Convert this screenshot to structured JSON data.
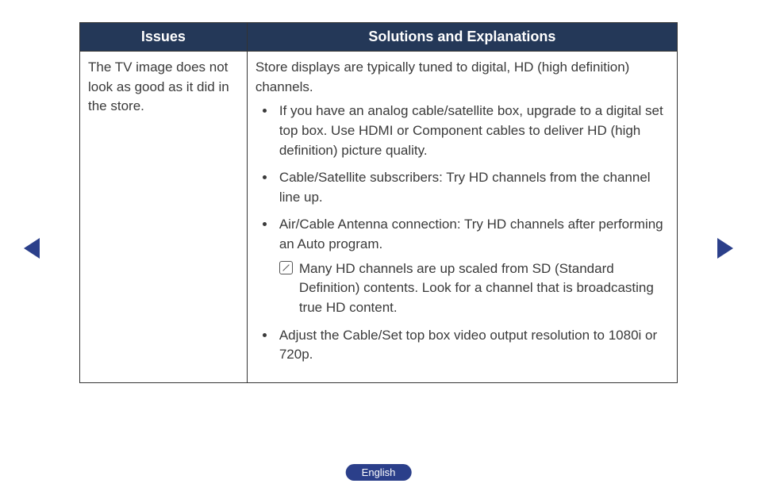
{
  "table": {
    "headers": {
      "issues": "Issues",
      "solutions": "Solutions and Explanations"
    },
    "row": {
      "issue": "The TV image does not look as good as it did in the store.",
      "intro": "Store displays are typically tuned to digital, HD (high definition) channels.",
      "bullets": [
        "If you have an analog cable/satellite box, upgrade to a digital set top box. Use HDMI or Component cables to deliver HD (high definition) picture quality.",
        "Cable/Satellite subscribers: Try HD channels from the channel line up.",
        "Air/Cable Antenna connection: Try HD channels after performing an Auto program.",
        "Adjust the Cable/Set top box video output resolution to 1080i or 720p."
      ],
      "note": "Many HD channels are up scaled from SD (Standard Definition) contents. Look for a channel that is broadcasting true HD content."
    }
  },
  "footer": {
    "language": "English"
  }
}
